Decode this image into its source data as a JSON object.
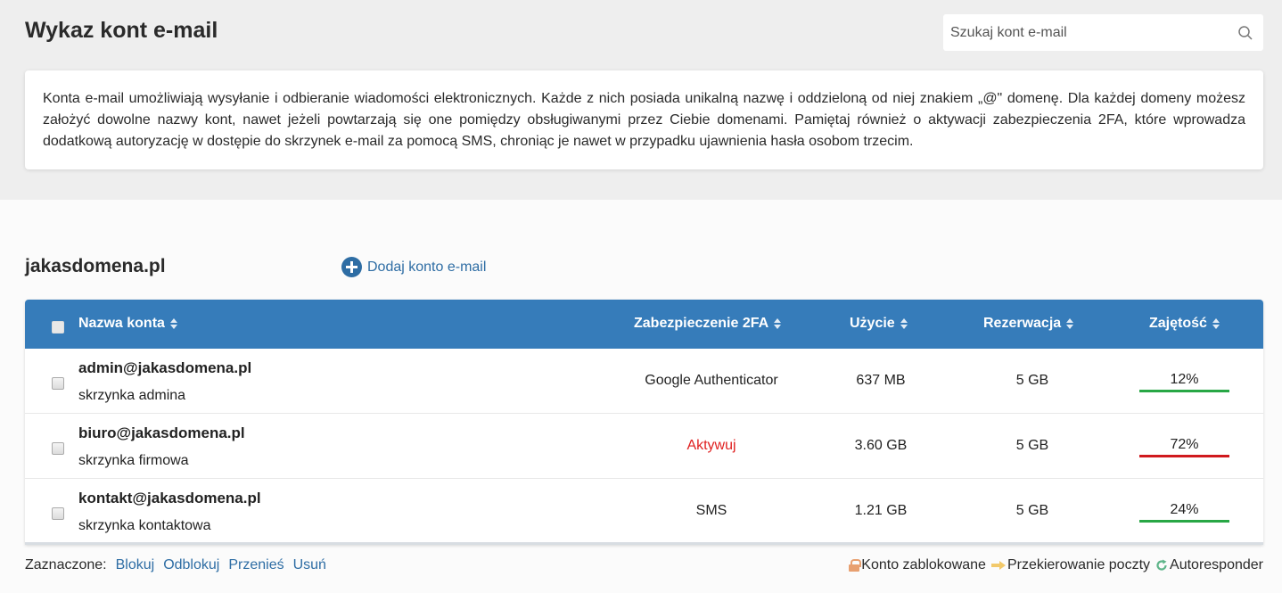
{
  "header": {
    "title": "Wykaz kont e-mail",
    "search_placeholder": "Szukaj kont e-mail"
  },
  "info": {
    "text": "Konta e-mail umożliwiają wysyłanie i odbieranie wiadomości elektronicznych. Każde z nich posiada unikalną nazwę i oddzieloną od niej znakiem „@\" domenę. Dla każdej domeny możesz założyć dowolne nazwy kont, nawet jeżeli powtarzają się one pomiędzy obsługiwanymi przez Ciebie domenami. Pamiętaj również o aktywacji zabezpieczenia 2FA, które wprowadza dodatkową autoryzację w dostępie do skrzynek e-mail za pomocą SMS, chroniąc je nawet w przypadku ujawnienia hasła osobom trzecim."
  },
  "domain": {
    "name": "jakasdomena.pl",
    "add_label": "Dodaj konto e-mail"
  },
  "table": {
    "columns": {
      "name": "Nazwa konta",
      "twofa": "Zabezpieczenie 2FA",
      "usage": "Użycie",
      "reservation": "Rezerwacja",
      "occupancy": "Zajętość"
    },
    "rows": [
      {
        "email": "admin@jakasdomena.pl",
        "description": "skrzynka admina",
        "twofa": "Google Authenticator",
        "usage": "637 MB",
        "reservation": "5 GB",
        "occupancy": "12%",
        "occupancy_color": "#28a745"
      },
      {
        "email": "biuro@jakasdomena.pl",
        "description": "skrzynka firmowa",
        "twofa": "Aktywuj",
        "usage": "3.60 GB",
        "reservation": "5 GB",
        "occupancy": "72%",
        "occupancy_color": "#d0191d"
      },
      {
        "email": "kontakt@jakasdomena.pl",
        "description": "skrzynka kontaktowa",
        "twofa": "SMS",
        "usage": "1.21 GB",
        "reservation": "5 GB",
        "occupancy": "24%",
        "occupancy_color": "#28a745"
      }
    ]
  },
  "footer": {
    "selected_label": "Zaznaczone:",
    "actions": [
      "Blokuj",
      "Odblokuj",
      "Przenieś",
      "Usuń"
    ],
    "legend": {
      "locked": "Konto zablokowane",
      "forward": "Przekierowanie poczty",
      "autoresponder": "Autoresponder"
    }
  },
  "colors": {
    "accent": "#367cba",
    "link": "#2e6da4",
    "danger": "#e02020",
    "ok": "#28a745"
  },
  "icons": {
    "search": "search-icon",
    "add": "plus-circle-icon",
    "sort": "sort-icon",
    "locked": "lock-icon",
    "forward": "arrow-right-icon",
    "autoresponder": "refresh-icon"
  }
}
